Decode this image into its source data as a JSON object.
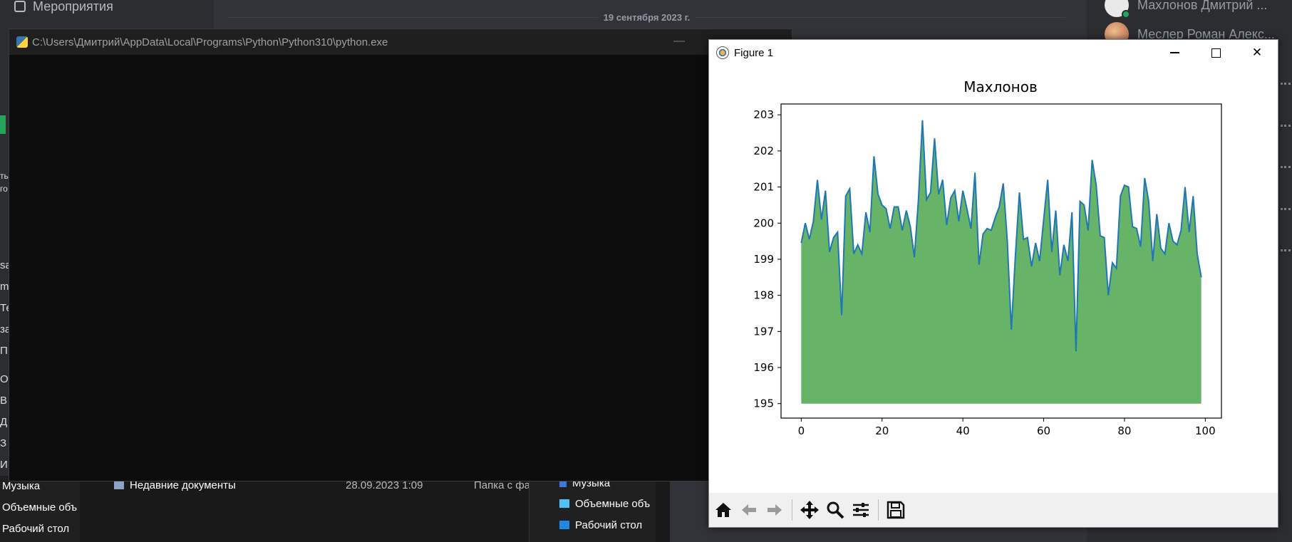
{
  "discord": {
    "events_label": "Мероприятия",
    "date_divider": "19 сентября 2023 г.",
    "members": [
      {
        "name": "Махлонов Дмитрий ..."
      },
      {
        "name": "Меслер Роман Алекс..."
      }
    ]
  },
  "sidebar_fragments": [
    "ть",
    "го",
    "sa",
    "m",
    "Те",
    "за",
    "П",
    "Ото",
    "В",
    "Д",
    "З",
    "И"
  ],
  "explorer": {
    "left_items": [
      "Музыка",
      "Объемные объ",
      "Рабочий стол"
    ],
    "row": {
      "name": "Недавние документы",
      "date": "28.09.2023 1:09",
      "type": "Папка с фа"
    },
    "nav_items": [
      {
        "label": "Музыка",
        "color": "#3a7bd5"
      },
      {
        "label": "Объемные объ",
        "color": "#4fc3f7"
      },
      {
        "label": "Рабочий стол",
        "color": "#1e88e5"
      }
    ]
  },
  "console": {
    "title": "C:\\Users\\Дмитрий\\AppData\\Local\\Programs\\Python\\Python310\\python.exe"
  },
  "figure": {
    "window_title": "Figure 1",
    "toolbar_icons": [
      "home-icon",
      "back-arrow-icon",
      "forward-arrow-icon",
      "pan-icon",
      "zoom-icon",
      "configure-subplots-icon",
      "save-icon"
    ]
  },
  "chart_data": {
    "type": "area",
    "title": "Махлонов",
    "xlabel": "",
    "ylabel": "",
    "xlim": [
      -5,
      104
    ],
    "ylim": [
      194.6,
      203.3
    ],
    "xticks": [
      0,
      20,
      40,
      60,
      80,
      100
    ],
    "yticks": [
      195,
      196,
      197,
      198,
      199,
      200,
      201,
      202,
      203
    ],
    "fill_baseline": 195,
    "line_color": "#1f77b4",
    "fill_color": "#4ca64c",
    "grid": false,
    "x_start": 0,
    "values": [
      199.45,
      200.0,
      199.55,
      200.05,
      201.2,
      200.1,
      200.9,
      199.2,
      199.6,
      199.75,
      197.45,
      200.75,
      200.95,
      199.15,
      199.4,
      199.15,
      200.3,
      199.75,
      201.85,
      200.8,
      200.5,
      200.4,
      199.85,
      200.45,
      200.45,
      199.8,
      200.35,
      199.9,
      199.05,
      200.65,
      202.85,
      200.65,
      200.85,
      202.35,
      200.8,
      201.2,
      199.95,
      200.7,
      200.9,
      200.05,
      200.9,
      200.4,
      199.85,
      201.4,
      198.85,
      199.7,
      199.85,
      199.8,
      200.15,
      200.45,
      201.1,
      199.5,
      197.05,
      199.1,
      200.85,
      199.55,
      199.6,
      198.8,
      199.45,
      198.95,
      200.1,
      201.2,
      199.2,
      200.35,
      198.55,
      199.4,
      198.95,
      200.3,
      196.45,
      200.6,
      200.5,
      199.8,
      201.75,
      201.05,
      199.65,
      199.6,
      198.0,
      198.9,
      198.75,
      200.75,
      201.05,
      201.0,
      199.9,
      199.85,
      199.35,
      201.25,
      200.6,
      198.95,
      200.25,
      199.3,
      199.15,
      200.0,
      199.5,
      199.4,
      199.8,
      201.0,
      199.75,
      200.75,
      199.15,
      198.5
    ]
  }
}
